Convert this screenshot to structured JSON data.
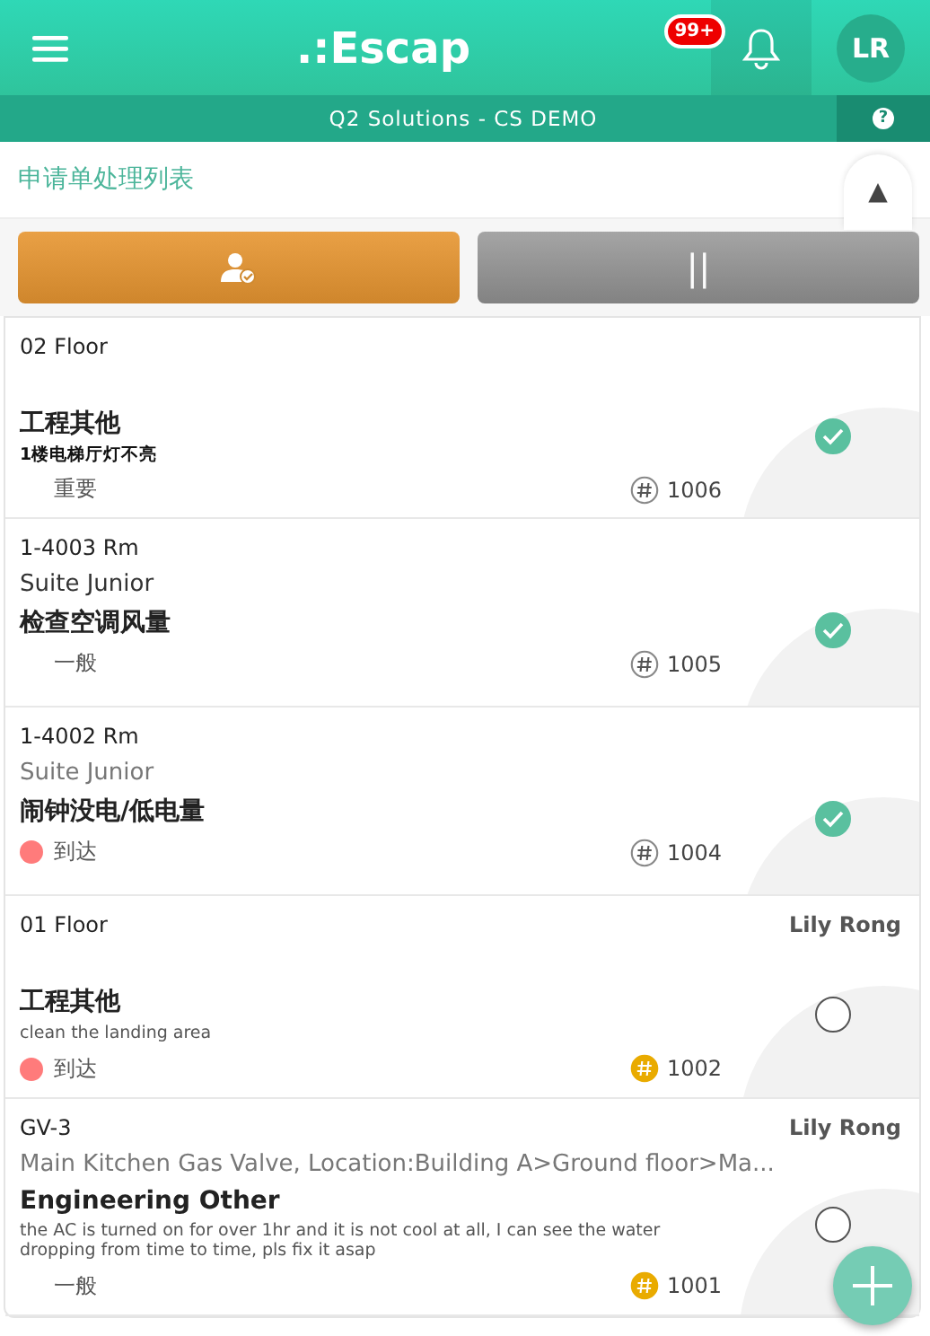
{
  "header": {
    "logo": ".:Escap",
    "badge": "99+",
    "avatar": "LR"
  },
  "subheader": {
    "title": "Q2 Solutions - CS DEMO",
    "help": "?"
  },
  "page_title": "申请单处理列表",
  "collapse_icon": "▲",
  "actions": [
    {
      "kind": "assign",
      "selected": true
    },
    {
      "kind": "pause",
      "selected": false,
      "label": "||"
    }
  ],
  "items": [
    {
      "location": "02 Floor",
      "title": "工程其他",
      "description": "1楼电梯厅灯不亮",
      "description_bold": true,
      "priority": "重要",
      "number": "1006",
      "hash_filled": false,
      "done": true
    },
    {
      "location": "1-4003 Rm",
      "subtitle": "Suite Junior",
      "subtitle_muted": false,
      "title": "检查空调风量",
      "priority": "一般",
      "number": "1005",
      "hash_filled": false,
      "done": true
    },
    {
      "location": "1-4002 Rm",
      "subtitle": "Suite Junior",
      "subtitle_muted": true,
      "title": "闹钟没电/低电量",
      "priority": "到达",
      "color": "#ff7b7b",
      "number": "1004",
      "hash_filled": false,
      "done": true
    },
    {
      "location": "01 Floor",
      "assignee": "Lily Rong",
      "title": "工程其他",
      "description": "clean the landing area",
      "description_bold": false,
      "priority": "到达",
      "color": "#ff7b7b",
      "number": "1002",
      "hash_filled": true,
      "done": false
    },
    {
      "location": "GV-3",
      "assignee": "Lily Rong",
      "subtitle": "Main Kitchen Gas Valve, Location:Building A>Ground floor>Ma...",
      "subtitle_muted": true,
      "title": "Engineering Other",
      "description": "the AC is turned on for over 1hr and it is not cool at all, I can see the water dropping from time to time, pls fix it asap",
      "description_bold": false,
      "priority": "一般",
      "number": "1001",
      "hash_filled": true,
      "done": false
    }
  ]
}
